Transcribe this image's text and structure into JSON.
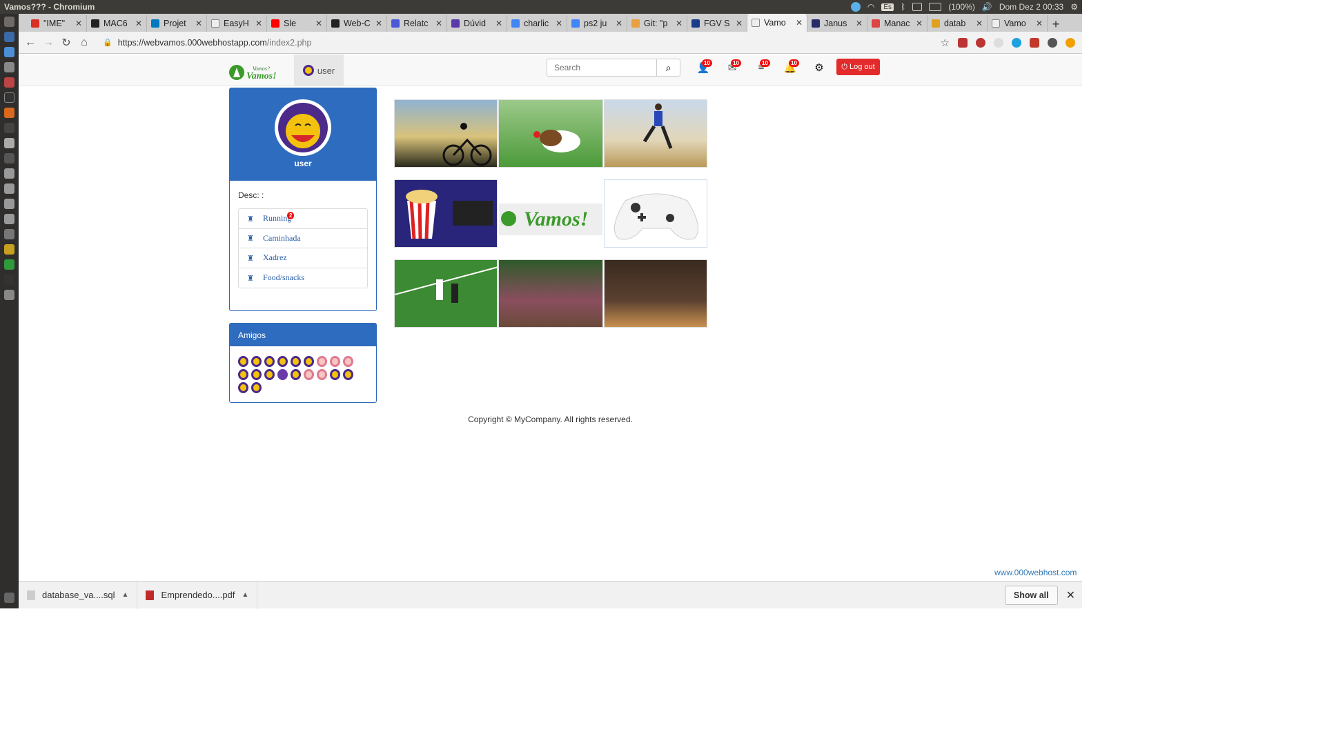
{
  "os": {
    "window_title": "Vamos??? - Chromium",
    "keyboard": "Es",
    "battery": "(100%)",
    "clock": "Dom Dez  2 00:33"
  },
  "tabs": [
    {
      "label": "\"IME\"",
      "icon": "gmail-icon"
    },
    {
      "label": "MAC6",
      "icon": "github-icon"
    },
    {
      "label": "Projet",
      "icon": "trello-icon"
    },
    {
      "label": "EasyH",
      "icon": "doc-icon"
    },
    {
      "label": "Sle",
      "icon": "youtube-icon"
    },
    {
      "label": "Web-C",
      "icon": "github-icon"
    },
    {
      "label": "Relatc",
      "icon": "docs-icon"
    },
    {
      "label": "Dúvid",
      "icon": "forum-icon"
    },
    {
      "label": "charlic",
      "icon": "google-icon"
    },
    {
      "label": "ps2 ju",
      "icon": "google-icon"
    },
    {
      "label": "Git: \"p",
      "icon": "git-icon"
    },
    {
      "label": "FGV S",
      "icon": "fgv-icon"
    },
    {
      "label": "Vamo",
      "icon": "doc-icon",
      "active": true
    },
    {
      "label": "Janus",
      "icon": "janus-icon"
    },
    {
      "label": "Manac",
      "icon": "manager-icon"
    },
    {
      "label": "datab",
      "icon": "db-icon"
    },
    {
      "label": "Vamo",
      "icon": "doc-icon"
    }
  ],
  "url": {
    "base": "https://webvamos.000webhostapp.com",
    "path": "/index2.php"
  },
  "navbar": {
    "user": "user",
    "search_placeholder": "Search",
    "badges": [
      "10",
      "10",
      "10",
      "10"
    ],
    "logout": "Log out"
  },
  "profile": {
    "name": "user",
    "desc": "Desc: :"
  },
  "activities": [
    {
      "label": "Running",
      "count": "2"
    },
    {
      "label": "Caminhada",
      "count": ""
    },
    {
      "label": "Xadrez",
      "count": ""
    },
    {
      "label": "Food/snacks",
      "count": ""
    }
  ],
  "friends": {
    "title": "Amigos",
    "count": 20
  },
  "photos": [
    "cyclist",
    "beagle",
    "runner",
    "popcorn-cinema",
    "vamos-logo",
    "game-controller",
    "soccer",
    "garden",
    "chefs"
  ],
  "logo_text": "Vamos?",
  "logo_text2": "Vamos!",
  "footer": "Copyright © MyCompany. All rights reserved.",
  "webhost_link": "www.000webhost.com",
  "downloads": [
    {
      "name": "database_va....sql",
      "type": "sql"
    },
    {
      "name": "Emprendedo....pdf",
      "type": "pdf"
    }
  ],
  "show_all": "Show all",
  "colors": {
    "primary": "#2e6cbf",
    "danger": "#e32b2b"
  }
}
